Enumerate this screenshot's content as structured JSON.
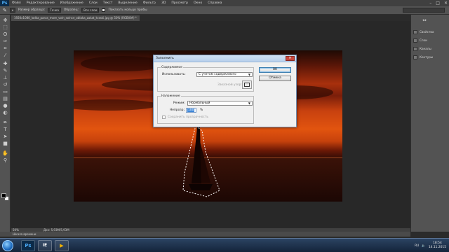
{
  "app": {
    "logo": "Ps"
  },
  "menu": [
    "Файл",
    "Редактирование",
    "Изображение",
    "Слои",
    "Текст",
    "Выделение",
    "Фильтр",
    "3D",
    "Просмотр",
    "Окно",
    "Справка"
  ],
  "window_controls": [
    "–",
    "□",
    "✕"
  ],
  "options": {
    "tool_icon": "healing-brush-icon",
    "size_label": "Размер образца:",
    "size_value": "Точка",
    "sample_label": "Образец:",
    "sample_value": "Все слои",
    "ring_label": "Показать кольцо пробы"
  },
  "document": {
    "tab_title": "1920x1080_lodka_parus_more_voln_solnce_oblaka_zakat_kraski.jpg @ 50% (RGB/8#) *",
    "close": "×"
  },
  "tools": [
    "move-icon",
    "marquee-icon",
    "lasso-icon",
    "quick-select-icon",
    "crop-icon",
    "eyedropper-icon",
    "healing-icon",
    "brush-icon",
    "stamp-icon",
    "history-brush-icon",
    "eraser-icon",
    "gradient-icon",
    "blur-icon",
    "dodge-icon",
    "pen-icon",
    "type-icon",
    "path-select-icon",
    "shape-icon",
    "hand-icon",
    "zoom-icon"
  ],
  "dialog": {
    "title": "Заполнить",
    "close": "✕",
    "contents_group": "Содержимое",
    "use_label": "Использовать:",
    "use_value": "С учетом содержимого",
    "custom_pattern_label": "Заказной узор:",
    "blending_group": "Наложение",
    "mode_label": "Режим:",
    "mode_value": "Нормальный",
    "opacity_label": "Непрозр.:",
    "opacity_value": "100",
    "opacity_unit": "%",
    "preserve_label": "Сохранить прозрачность",
    "ok": "ОК",
    "cancel": "Отмена"
  },
  "dock": {
    "items": [
      {
        "icon": "properties-icon",
        "label": "Свойства"
      },
      {
        "icon": "layers-icon",
        "label": "Слои"
      },
      {
        "icon": "channels-icon",
        "label": "Каналы"
      },
      {
        "icon": "paths-icon",
        "label": "Контуры"
      }
    ]
  },
  "status": {
    "zoom": "50%",
    "doc_size": "Док: 5,93M/5,93M"
  },
  "timeline_tab": "Шкала времени",
  "taskbar": {
    "apps": [
      "Ps",
      "IE",
      "▶"
    ],
    "lang": "RU",
    "time": "18:54",
    "date": "14.11.2015"
  }
}
